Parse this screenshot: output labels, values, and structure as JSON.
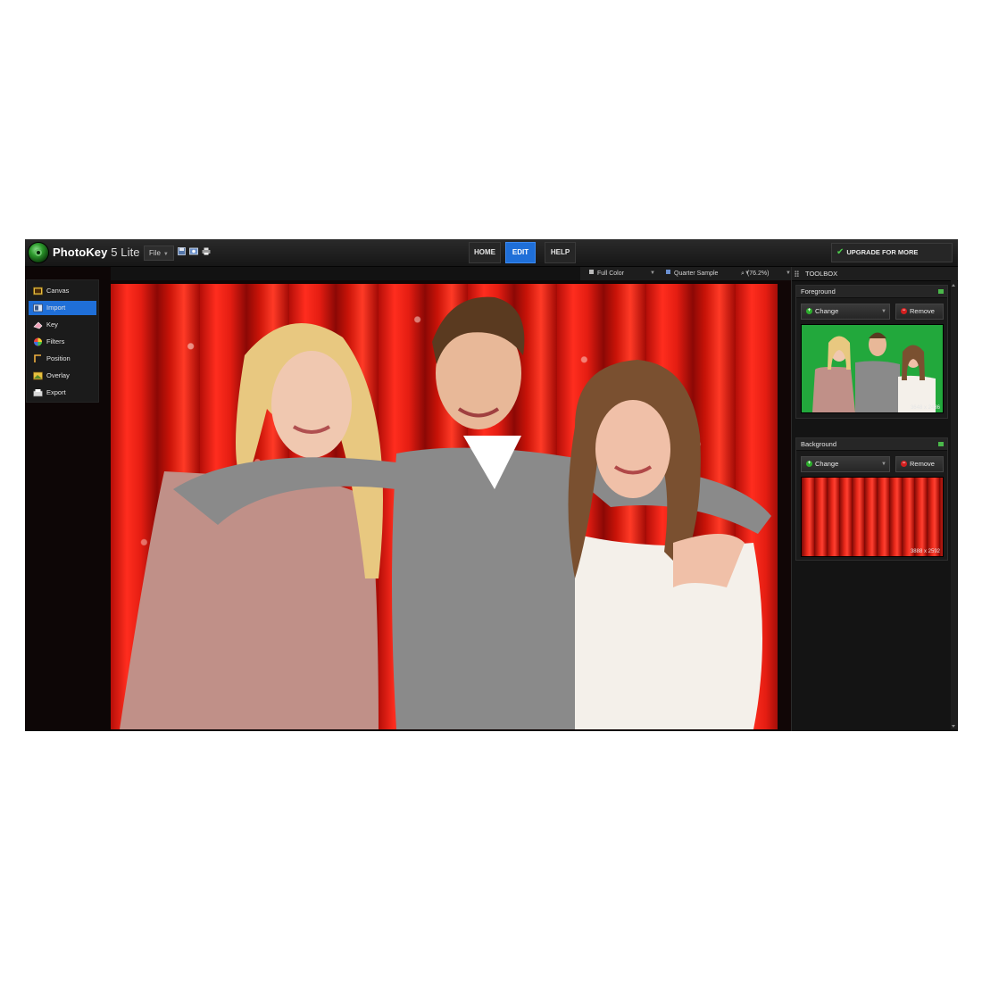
{
  "app": {
    "name": "PhotoKey",
    "version": "5 Lite",
    "file_menu": "File"
  },
  "nav": {
    "tabs": [
      {
        "label": "HOME",
        "active": false
      },
      {
        "label": "EDIT",
        "active": true
      },
      {
        "label": "HELP",
        "active": false
      }
    ]
  },
  "upgrade": {
    "label": "UPGRADE FOR MORE FEATURES"
  },
  "sidebar": {
    "items": [
      {
        "label": "Canvas",
        "icon": "canvas-icon",
        "active": false
      },
      {
        "label": "Import",
        "icon": "import-icon",
        "active": true
      },
      {
        "label": "Key",
        "icon": "eraser-icon",
        "active": false
      },
      {
        "label": "Filters",
        "icon": "color-wheel-icon",
        "active": false
      },
      {
        "label": "Position",
        "icon": "position-icon",
        "active": false
      },
      {
        "label": "Overlay",
        "icon": "overlay-icon",
        "active": false
      },
      {
        "label": "Export",
        "icon": "export-icon",
        "active": false
      }
    ]
  },
  "view_options": {
    "color_mode": "Full Color",
    "sample": "Quarter Sample",
    "zoom": "(76.2%)"
  },
  "toolbox": {
    "title": "TOOLBOX",
    "foreground": {
      "title": "Foreground",
      "change_label": "Change",
      "remove_label": "Remove",
      "dimensions": "3648 x 2436"
    },
    "background": {
      "title": "Background",
      "change_label": "Change",
      "remove_label": "Remove",
      "dimensions": "3888 x 2592"
    }
  },
  "colors": {
    "accent": "#1f6fd8",
    "backdrop_red": "#e41d12",
    "green_screen": "#1fa23a",
    "add_green": "#2cae2c",
    "remove_red": "#d21f1f"
  }
}
